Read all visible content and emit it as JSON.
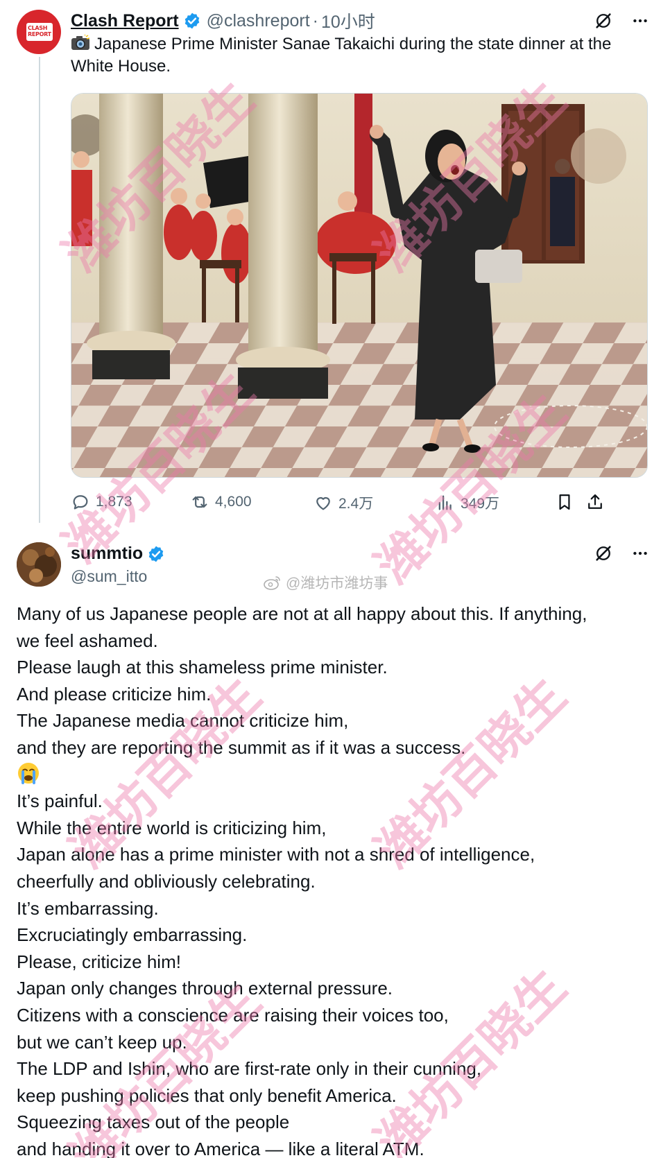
{
  "post1": {
    "author_name": "Clash Report",
    "avatar_text": "CLASH REPORT",
    "handle": "@clashreport",
    "separator": "·",
    "time": "10小时",
    "text": "Japanese Prime Minister Sanae Takaichi during the state dinner at the White House.",
    "metrics": {
      "replies": "1,873",
      "reposts": "4,600",
      "likes": "2.4万",
      "views": "349万"
    }
  },
  "post2": {
    "author_name": "summtio",
    "handle": "@sum_itto",
    "lines": [
      "Many of us Japanese people are not at all happy about this. If anything,",
      "we feel ashamed.",
      "Please laugh at this shameless prime minister.",
      "And please criticize him.",
      "The Japanese media cannot criticize him,",
      "and they are reporting the summit as if it was a success.",
      "",
      "It’s painful.",
      "While the entire world is criticizing him,",
      "Japan alone has a prime minister with not a shred of intelligence,",
      "cheerfully and obliviously celebrating.",
      "It’s embarrassing.",
      "Excruciatingly embarrassing.",
      "Please, criticize him!",
      "Japan only changes through external pressure.",
      "Citizens with a conscience are raising their voices too,",
      "but we can’t keep up.",
      "The LDP and Ishin, who are first-rate only in their cunning,",
      "keep pushing policies that only benefit America.",
      "Squeezing taxes out of the people",
      "and handing it over to America — like a literal ATM."
    ]
  },
  "watermark": {
    "text": "潍坊百晓生",
    "weibo_tag": "@潍坊市潍坊事"
  },
  "colors": {
    "verified": "#1d9bf0",
    "secondary_text": "#536471",
    "brand_red": "#d8262c"
  },
  "icons": [
    "verified-badge-icon",
    "grok-icon",
    "more-icon",
    "reply-icon",
    "repost-icon",
    "like-icon",
    "views-icon",
    "bookmark-icon",
    "share-icon",
    "camera-emoji-icon",
    "crying-emoji-icon",
    "weibo-icon"
  ]
}
